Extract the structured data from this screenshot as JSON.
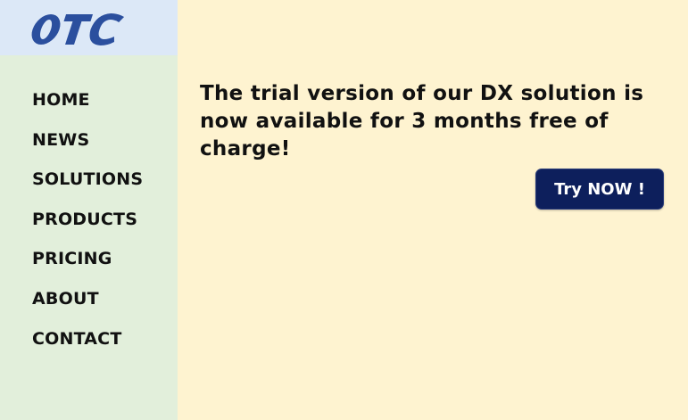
{
  "logo": {
    "text": "OTC",
    "color": "#2b4f9e"
  },
  "nav": {
    "items": [
      {
        "label": "HOME"
      },
      {
        "label": "NEWS"
      },
      {
        "label": "SOLUTIONS"
      },
      {
        "label": "PRODUCTS"
      },
      {
        "label": "PRICING"
      },
      {
        "label": "ABOUT"
      },
      {
        "label": "CONTACT"
      }
    ]
  },
  "main": {
    "headline_line1": "The trial version of our DX solution is",
    "headline_line2": "now available for 3 months free of charge!",
    "cta_label": "Try NOW !"
  },
  "colors": {
    "logo_bg": "#dce8f7",
    "sidebar_bg": "#e2efdb",
    "main_bg": "#fef3d0",
    "cta_bg": "#0d1f5c"
  }
}
